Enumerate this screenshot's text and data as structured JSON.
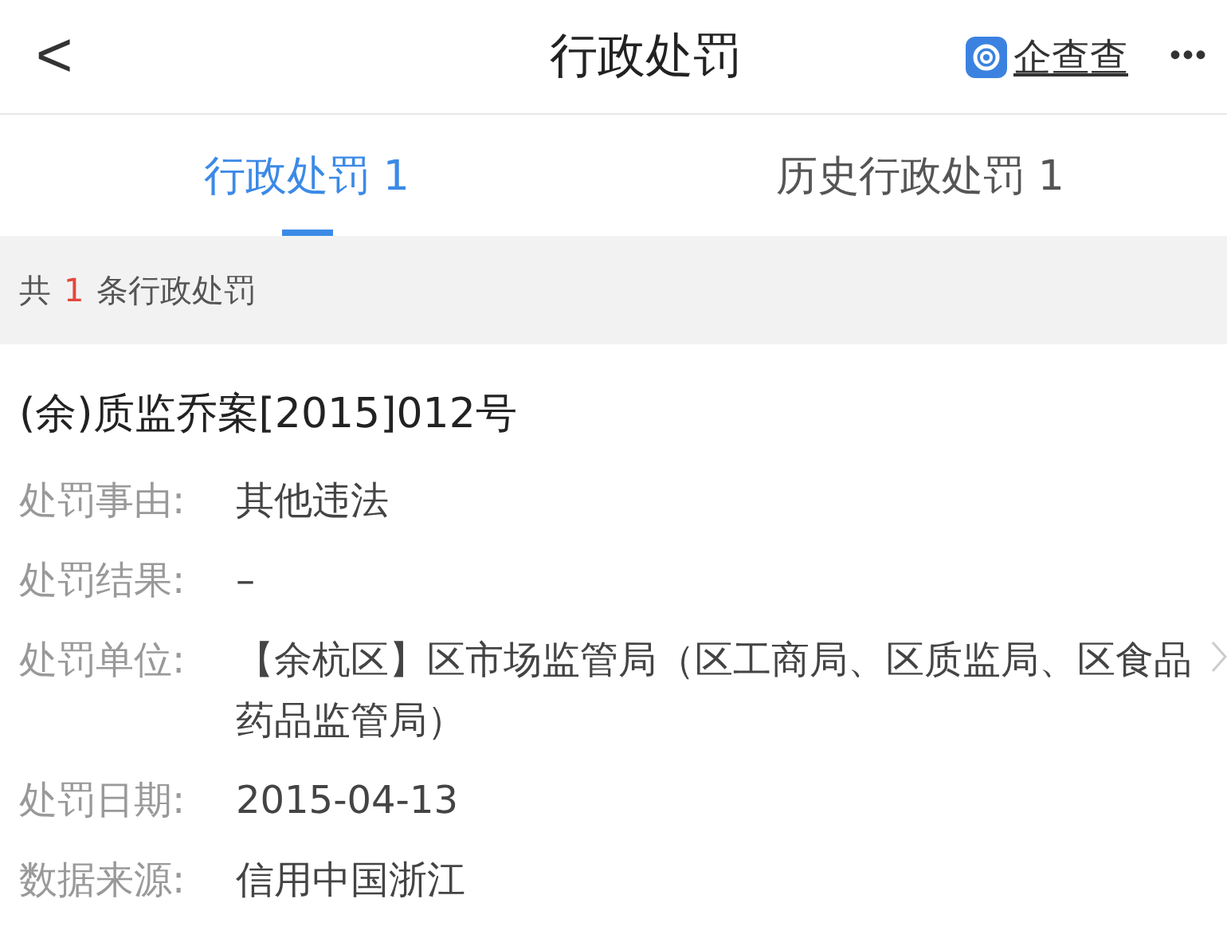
{
  "header": {
    "back": "<",
    "title": "行政处罚",
    "brand": "企查查",
    "more": "•••"
  },
  "tabs": [
    {
      "label": "行政处罚 1",
      "selected": true
    },
    {
      "label": "历史行政处罚 1",
      "selected": false
    }
  ],
  "summary": {
    "prefix": "共",
    "count": "1",
    "suffix": "条行政处罚"
  },
  "record": {
    "title": "(余)质监乔案[2015]012号",
    "fields": [
      {
        "label": "处罚事由:",
        "value": "其他违法"
      },
      {
        "label": "处罚结果:",
        "value": "–"
      },
      {
        "label": "处罚单位:",
        "value": "【余杭区】区市场监管局（区工商局、区质监局、区食品药品监管局）"
      },
      {
        "label": "处罚日期:",
        "value": "2015-04-13"
      },
      {
        "label": "数据来源:",
        "value": "信用中国浙江"
      }
    ]
  }
}
